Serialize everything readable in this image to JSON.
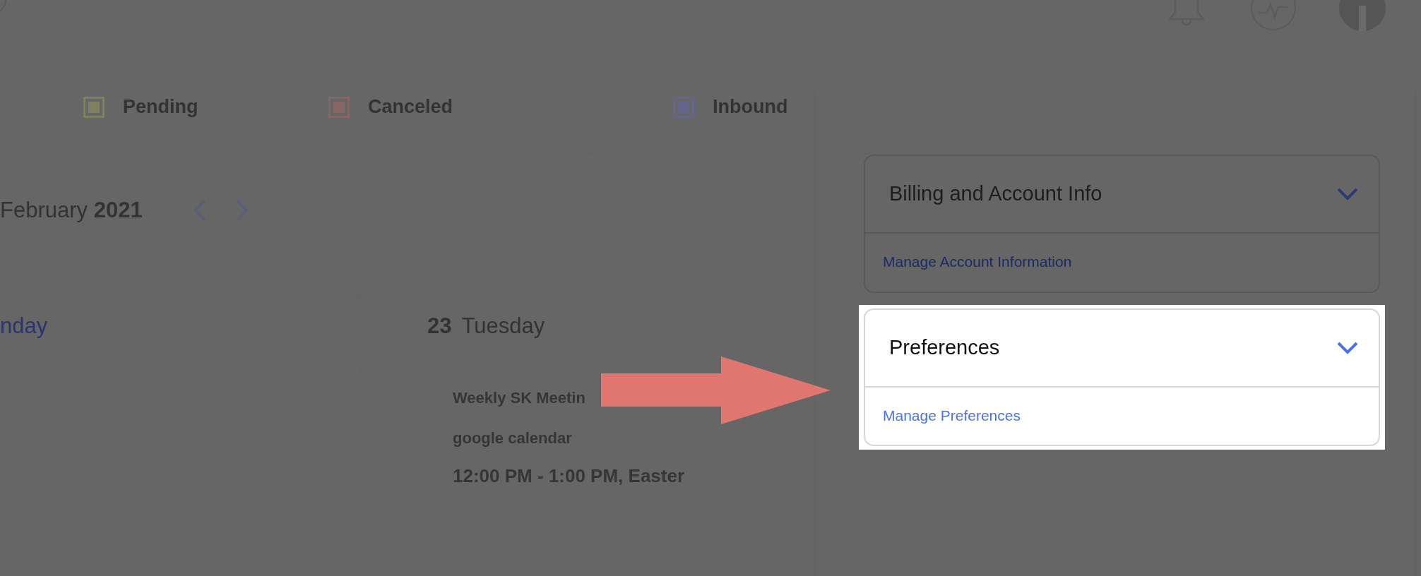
{
  "legend": [
    {
      "label": "Pending",
      "color": "#7f8060"
    },
    {
      "label": "Canceled",
      "color": "#876565"
    },
    {
      "label": "Inbound",
      "color": "#63658a"
    }
  ],
  "calendar": {
    "month": "February",
    "year": "2021",
    "days": [
      {
        "weekday": "nday",
        "today": true
      },
      {
        "date": "23",
        "weekday": "Tuesday",
        "today": false,
        "events": [
          {
            "title": "Weekly SK Meetin",
            "source": "google calendar",
            "time": "12:00 PM - 1:00 PM, Easter"
          }
        ]
      }
    ]
  },
  "settings_panel": {
    "sections": [
      {
        "title": "Billing and Account Info",
        "link": "Manage Account Information",
        "highlighted": false
      },
      {
        "title": "Preferences",
        "link": "Manage Preferences",
        "highlighted": true
      }
    ]
  }
}
